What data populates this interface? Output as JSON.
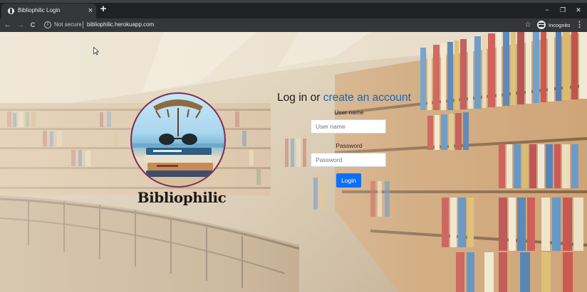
{
  "browser": {
    "tab_title": "Bibliophilic Login",
    "tab_close": "×",
    "new_tab": "+",
    "window_minimize": "−",
    "window_restore": "❐",
    "window_close": "✕",
    "nav_back": "←",
    "nav_forward": "→",
    "nav_reload": "C",
    "info_symbol": "i",
    "security_label": "Not secure",
    "url": "bibliophilic.herokuapp.com",
    "bookmark_star": "☆",
    "incognito_label": "Incognito",
    "menu_symbol": "⋮"
  },
  "icons": {
    "tab_favicon": "globe-icon",
    "back": "arrow-left-icon",
    "forward": "arrow-right-icon",
    "reload": "reload-icon",
    "info": "info-icon",
    "star": "star-icon",
    "incognito": "incognito-icon",
    "menu": "kebab-menu-icon"
  },
  "page": {
    "brand_name": "Bibliophilic",
    "login_title_prefix": "Log in or ",
    "login_title_link": "create an account",
    "username_label": "User name",
    "username_placeholder": "User name",
    "username_value": "",
    "password_label": "Password",
    "password_placeholder": "Password",
    "password_value": "",
    "login_button": "Login"
  },
  "colors": {
    "link": "#1766b3",
    "button": "#0d6efd",
    "logo_border": "#7d2c58",
    "chrome_dark": "#202124",
    "chrome_toolbar": "#35363a"
  }
}
